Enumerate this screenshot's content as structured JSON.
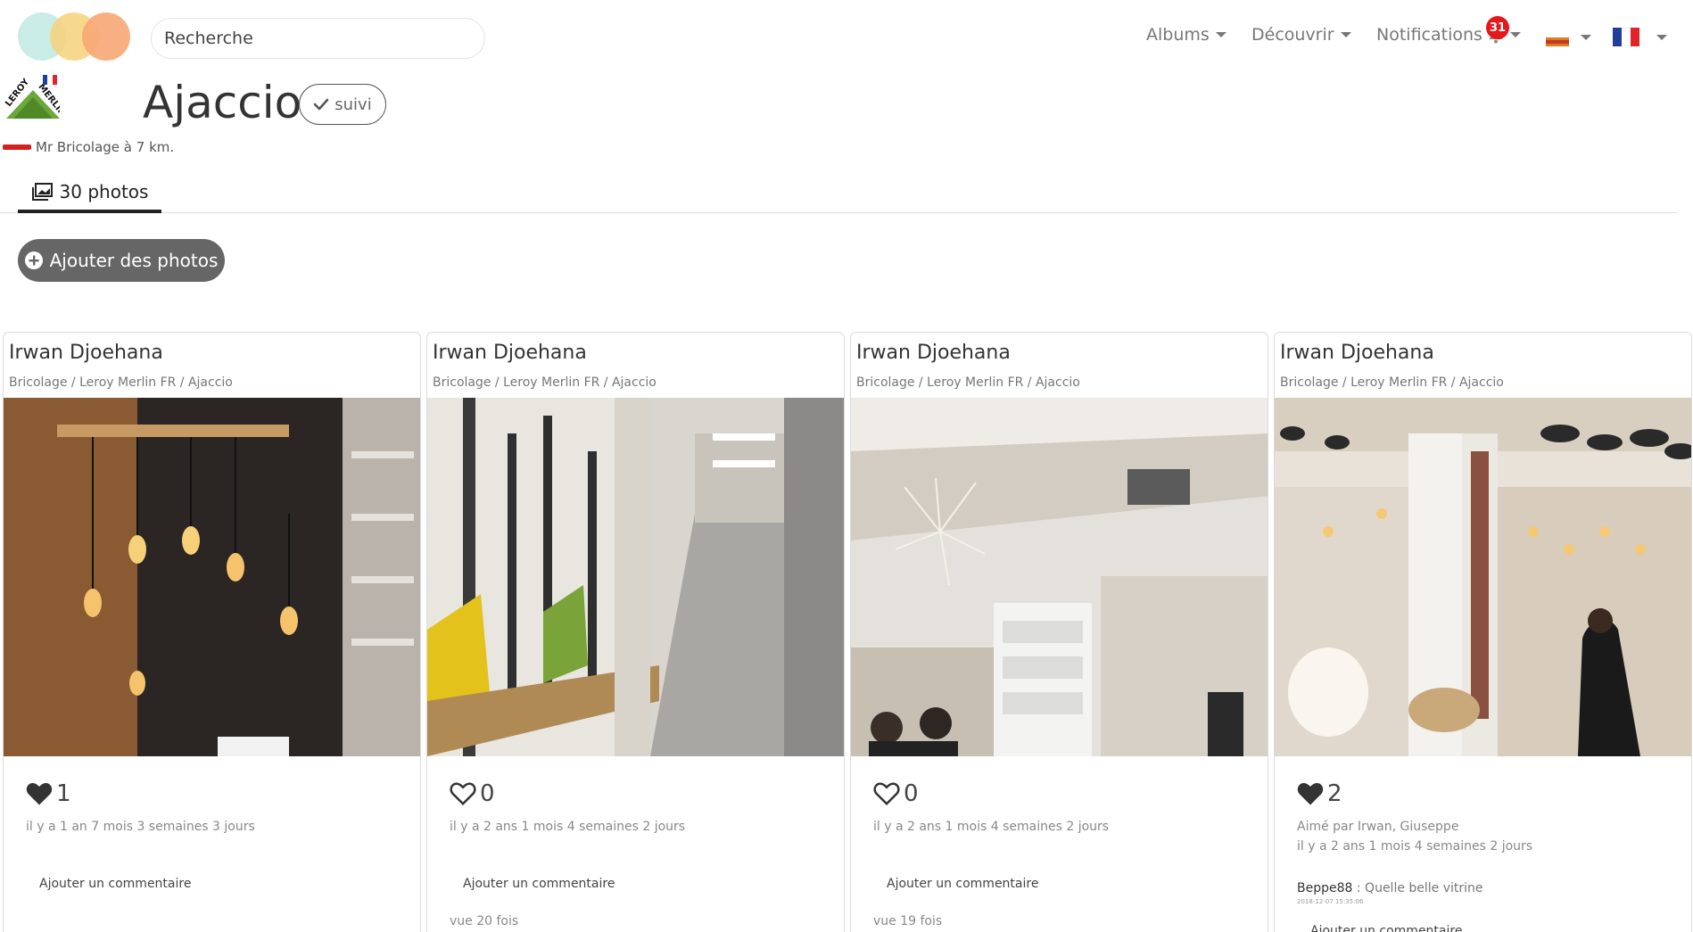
{
  "search": {
    "placeholder": "Recherche"
  },
  "nav": {
    "albums": "Albums",
    "discover": "Découvrir",
    "notifications": "Notifications",
    "notification_count": "31"
  },
  "store": {
    "title": "Ajaccio",
    "follow_label": "suivi",
    "nearby": "Mr Bricolage à 7 km."
  },
  "tabs": {
    "photos": "30 photos"
  },
  "actions": {
    "add_photos": "Ajouter des photos"
  },
  "cards": [
    {
      "author": "Irwan Djoehana",
      "path": "Bricolage / Leroy Merlin FR / Ajaccio",
      "likes": "1",
      "liked": true,
      "time": "il y a 1 an 7 mois 3 semaines 3 jours",
      "add_comment": "Ajouter un commentaire"
    },
    {
      "author": "Irwan Djoehana",
      "path": "Bricolage / Leroy Merlin FR / Ajaccio",
      "likes": "0",
      "liked": false,
      "time": "il y a 2 ans 1 mois 4 semaines 2 jours",
      "add_comment": "Ajouter un commentaire",
      "views": "vue 20 fois"
    },
    {
      "author": "Irwan Djoehana",
      "path": "Bricolage / Leroy Merlin FR / Ajaccio",
      "likes": "0",
      "liked": false,
      "time": "il y a 2 ans 1 mois 4 semaines 2 jours",
      "add_comment": "Ajouter un commentaire",
      "views": "vue 19 fois"
    },
    {
      "author": "Irwan Djoehana",
      "path": "Bricolage / Leroy Merlin FR / Ajaccio",
      "likes": "2",
      "liked": true,
      "liked_by": "Aimé par Irwan, Giuseppe",
      "time": "il y a 2 ans 1 mois 4 semaines 2 jours",
      "comment_author": "Beppe88",
      "comment_text": "Quelle belle vitrine",
      "comment_date": "2018-12-07 15:35:06",
      "add_comment": "Ajouter un commentaire"
    }
  ],
  "colors": {
    "logo": [
      "#bfe9e3",
      "#f6d27a",
      "#f7a776"
    ],
    "badge": "#e5181b",
    "add_button": "#666666",
    "leroy_merlin_green": "#6aa83a",
    "fr_flag": [
      "#1f3f9a",
      "#ffffff",
      "#e1232a"
    ]
  },
  "icons": {
    "bell": "bell-icon",
    "heart_filled": "heart-filled-icon",
    "heart_outline": "heart-outline-icon",
    "photos": "photos-icon",
    "plus": "plus-circle-icon",
    "check": "check-icon"
  }
}
